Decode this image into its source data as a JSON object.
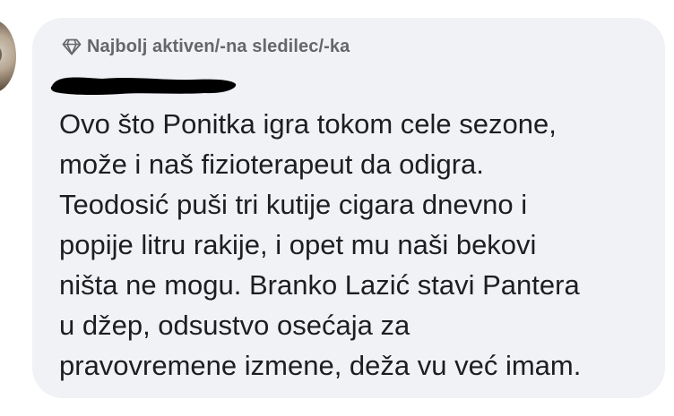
{
  "comment": {
    "badge": {
      "icon": "diamond-icon",
      "label": "Najbolj aktiven/-na sledilec/-ka",
      "color": "#65676b"
    },
    "author_redacted": true,
    "text": "Ovo što Ponitka igra tokom cele sezone,\nmože i naš fizioterapeut da odigra.\nTeodosić puši tri kutije cigara dnevno i\npopije litru rakije, i opet mu naši bekovi\nništa ne mogu. Branko Lazić stavi Pantera\nu džep, odsustvo osećaja za\npravovremene izmene, deža vu već imam.",
    "bubble_color": "#f0f2f5"
  }
}
